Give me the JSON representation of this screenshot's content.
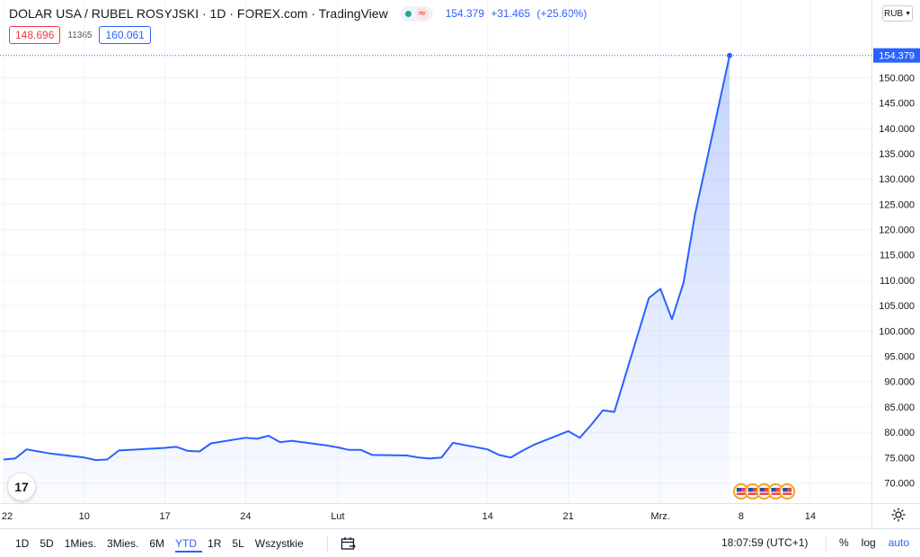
{
  "header": {
    "title": "DOLAR USA / RUBEL ROSYJSKI · 1D · FOREX.com · TradingView",
    "last_price": "154.379",
    "change": "+31.465",
    "change_pct": "(+25.60%)",
    "wave_symbol": "≈"
  },
  "pricebar": {
    "sell": "148.696",
    "spread": "11365",
    "buy": "160.061"
  },
  "currency": "RUB",
  "tv_logo": "17",
  "colors": {
    "line": "#2962ff",
    "area_top": "#2962ff",
    "sell": "#f23645",
    "buy": "#2962ff"
  },
  "chart_data": {
    "type": "area",
    "x": [
      "2022-01-03",
      "2022-01-04",
      "2022-01-05",
      "2022-01-06",
      "2022-01-07",
      "2022-01-10",
      "2022-01-11",
      "2022-01-12",
      "2022-01-13",
      "2022-01-14",
      "2022-01-17",
      "2022-01-18",
      "2022-01-19",
      "2022-01-20",
      "2022-01-21",
      "2022-01-24",
      "2022-01-25",
      "2022-01-26",
      "2022-01-27",
      "2022-01-28",
      "2022-01-31",
      "2022-02-01",
      "2022-02-02",
      "2022-02-03",
      "2022-02-04",
      "2022-02-07",
      "2022-02-08",
      "2022-02-09",
      "2022-02-10",
      "2022-02-11",
      "2022-02-14",
      "2022-02-15",
      "2022-02-16",
      "2022-02-17",
      "2022-02-18",
      "2022-02-21",
      "2022-02-22",
      "2022-02-23",
      "2022-02-24",
      "2022-02-25",
      "2022-02-28",
      "2022-03-01",
      "2022-03-02",
      "2022-03-03",
      "2022-03-04",
      "2022-03-07"
    ],
    "values": [
      74.6,
      74.8,
      76.6,
      76.2,
      75.8,
      75.0,
      74.5,
      74.6,
      76.4,
      76.5,
      76.9,
      77.1,
      76.3,
      76.2,
      77.8,
      78.9,
      78.7,
      79.3,
      78.0,
      78.3,
      77.4,
      77.0,
      76.5,
      76.5,
      75.5,
      75.4,
      75.0,
      74.8,
      75.0,
      77.9,
      76.6,
      75.5,
      75.0,
      76.3,
      77.5,
      80.2,
      78.9,
      81.5,
      84.3,
      84.0,
      106.5,
      108.3,
      102.3,
      109.5,
      123.0,
      154.379
    ],
    "y_axis": {
      "min": 66.0,
      "max": 160.0,
      "ticks": [
        70,
        75,
        80,
        85,
        90,
        95,
        100,
        105,
        110,
        115,
        120,
        125,
        130,
        135,
        140,
        145,
        150
      ],
      "tick_labels": [
        "70.000",
        "75.000",
        "80.000",
        "85.000",
        "90.000",
        "95.000",
        "100.000",
        "105.000",
        "110.000",
        "115.000",
        "120.000",
        "125.000",
        "130.000",
        "135.000",
        "140.000",
        "145.000",
        "150.000"
      ],
      "last_value_label": "154.379"
    },
    "x_axis": {
      "tick_labels": [
        "22",
        "10",
        "17",
        "24",
        "Lut",
        "14",
        "21",
        "Mrz.",
        "8",
        "14"
      ],
      "tick_dates": [
        "2022-01-03",
        "2022-01-10",
        "2022-01-17",
        "2022-01-24",
        "2022-02-01",
        "2022-02-14",
        "2022-02-21",
        "2022-03-01",
        "2022-03-08",
        "2022-03-14"
      ],
      "range": [
        "2022-01-03",
        "2022-03-19"
      ]
    },
    "event_markers": [
      "2022-03-08",
      "2022-03-09",
      "2022-03-10",
      "2022-03-11",
      "2022-03-12"
    ],
    "grid": true
  },
  "ranges": [
    {
      "label": "1D",
      "active": false
    },
    {
      "label": "5D",
      "active": false
    },
    {
      "label": "1Mies.",
      "active": false
    },
    {
      "label": "3Mies.",
      "active": false
    },
    {
      "label": "6M",
      "active": false
    },
    {
      "label": "YTD",
      "active": true
    },
    {
      "label": "1R",
      "active": false
    },
    {
      "label": "5L",
      "active": false
    },
    {
      "label": "Wszystkie",
      "active": false
    }
  ],
  "clock": "18:07:59 (UTC+1)",
  "bottom_options": [
    {
      "label": "%",
      "active": false
    },
    {
      "label": "log",
      "active": false
    },
    {
      "label": "auto",
      "active": true
    }
  ]
}
